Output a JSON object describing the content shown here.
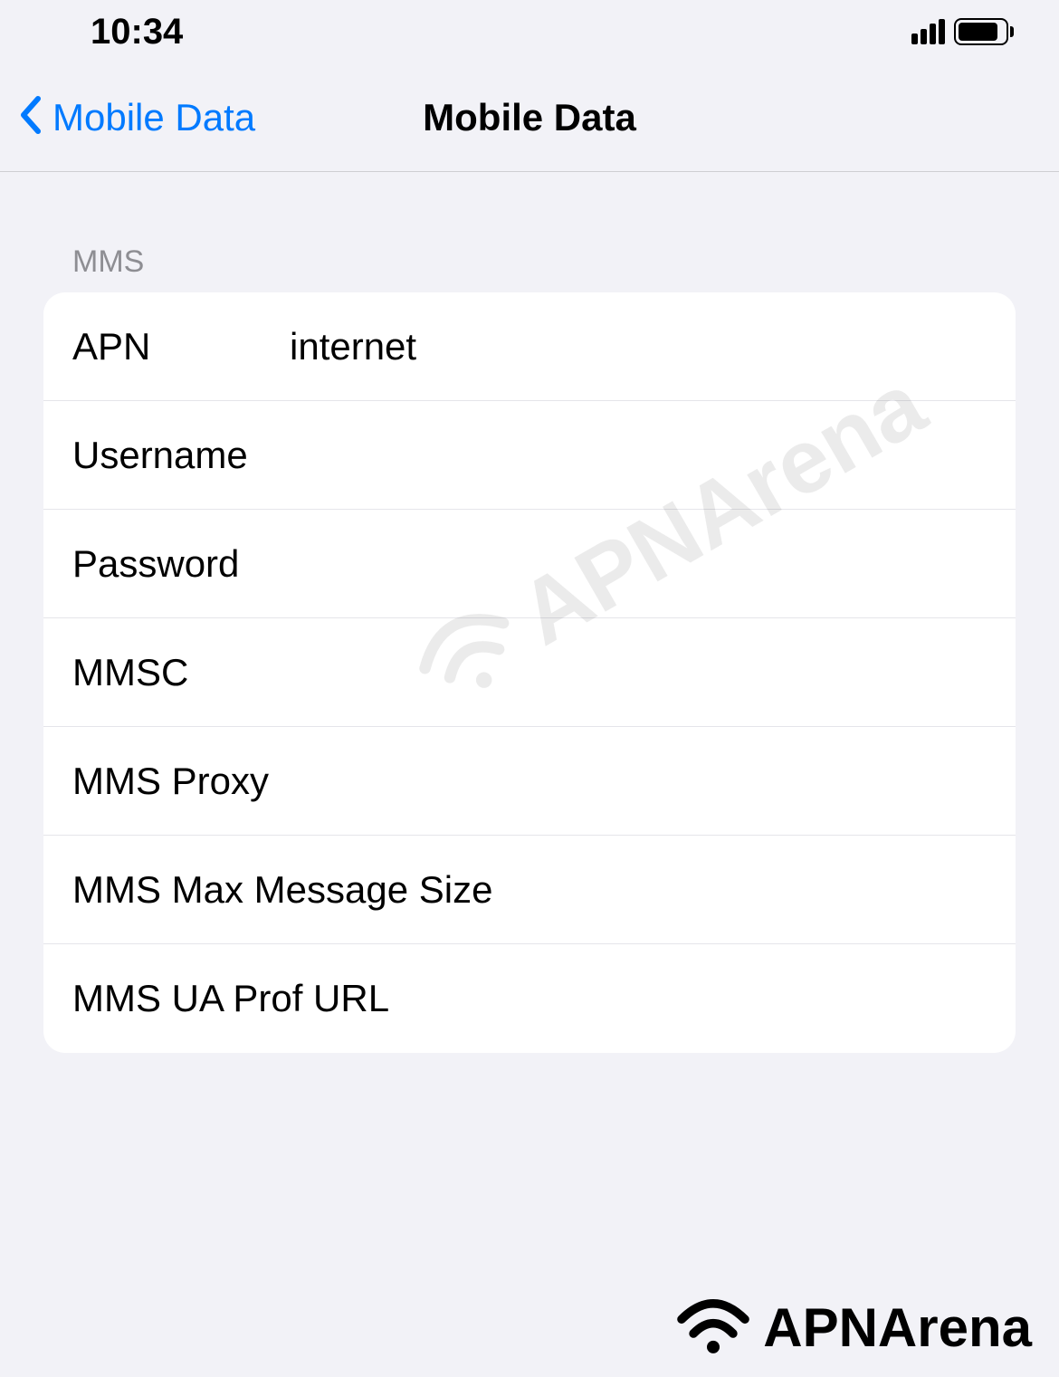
{
  "statusBar": {
    "time": "10:34"
  },
  "navBar": {
    "backLabel": "Mobile Data",
    "title": "Mobile Data"
  },
  "section": {
    "header": "MMS",
    "rows": [
      {
        "label": "APN",
        "value": "internet"
      },
      {
        "label": "Username",
        "value": ""
      },
      {
        "label": "Password",
        "value": ""
      },
      {
        "label": "MMSC",
        "value": ""
      },
      {
        "label": "MMS Proxy",
        "value": ""
      },
      {
        "label": "MMS Max Message Size",
        "value": ""
      },
      {
        "label": "MMS UA Prof URL",
        "value": ""
      }
    ]
  },
  "watermark": "APNArena",
  "footerLogo": "APNArena"
}
